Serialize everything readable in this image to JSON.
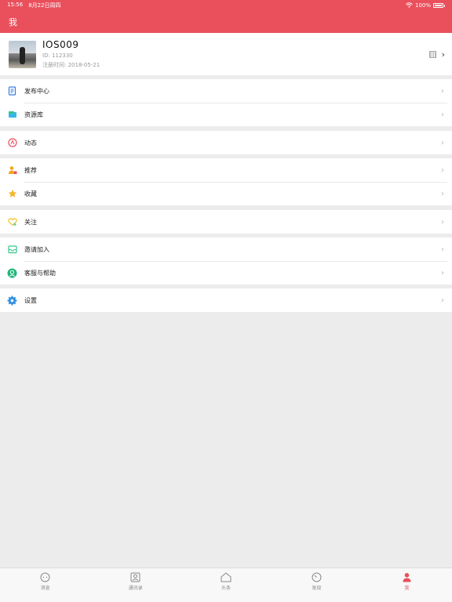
{
  "status": {
    "time": "15:56",
    "date": "8月22日周四",
    "battery": "100%"
  },
  "nav": {
    "title": "我"
  },
  "profile": {
    "name": "IOS009",
    "id": "ID: 112330",
    "registered": "注册时间: 2018-05-21"
  },
  "menu": {
    "publish": "发布中心",
    "library": "资源库",
    "dynamic": "动态",
    "recommend": "推荐",
    "favorites": "收藏",
    "follow": "关注",
    "invite": "邀请加入",
    "support": "客服与帮助",
    "settings": "设置"
  },
  "tabs": {
    "messages": "消息",
    "contacts": "通讯录",
    "headlines": "头条",
    "discover": "发现",
    "me": "我"
  },
  "colors": {
    "accent": "#e9505c",
    "background": "#ececec"
  }
}
